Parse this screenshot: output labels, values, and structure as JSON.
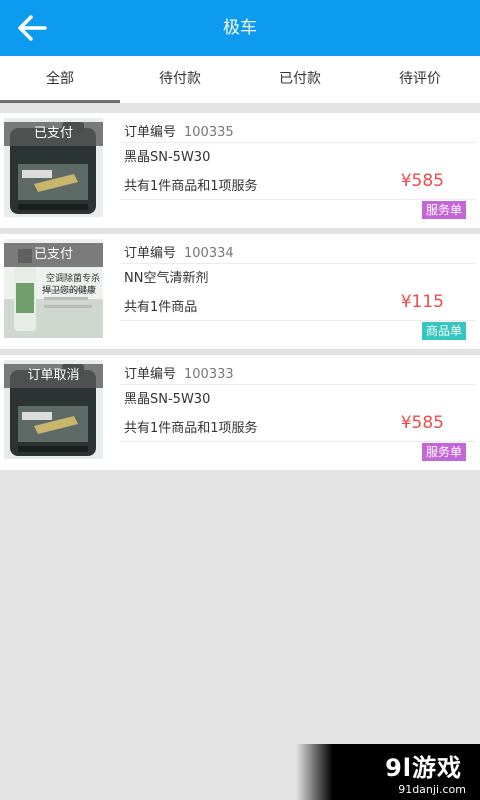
{
  "header": {
    "title": "极车",
    "back_icon": "arrow-left-icon"
  },
  "tabs": [
    {
      "label": "全部",
      "active": true
    },
    {
      "label": "待付款",
      "active": false
    },
    {
      "label": "已付款",
      "active": false
    },
    {
      "label": "待评价",
      "active": false
    }
  ],
  "orders": [
    {
      "status": "已支付",
      "order_no_label": "订单编号",
      "order_no": "100335",
      "product": "黑晶SN-5W30",
      "summary": "共有1件商品和1项服务",
      "price": "¥585",
      "type": "服务单",
      "type_color": "#c566d8",
      "image": "motor-oil-bottle"
    },
    {
      "status": "已支付",
      "order_no_label": "订单编号",
      "order_no": "100334",
      "product": "NN空气清新剂",
      "summary": "共有1件商品",
      "price": "¥115",
      "type": "商品单",
      "type_color": "#35c6c0",
      "image": "air-freshener-bottle",
      "image_text": [
        "空调除菌专杀",
        "捍卫您的健康"
      ]
    },
    {
      "status": "订单取消",
      "order_no_label": "订单编号",
      "order_no": "100333",
      "product": "黑晶SN-5W30",
      "summary": "共有1件商品和1项服务",
      "price": "¥585",
      "type": "服务单",
      "type_color": "#c566d8",
      "image": "motor-oil-bottle"
    }
  ],
  "watermark": {
    "logo": "9l游戏",
    "url": "91danji.com"
  },
  "colors": {
    "header": "#0c9bee",
    "price": "#ef4b4b",
    "background": "#e3e3e3"
  }
}
